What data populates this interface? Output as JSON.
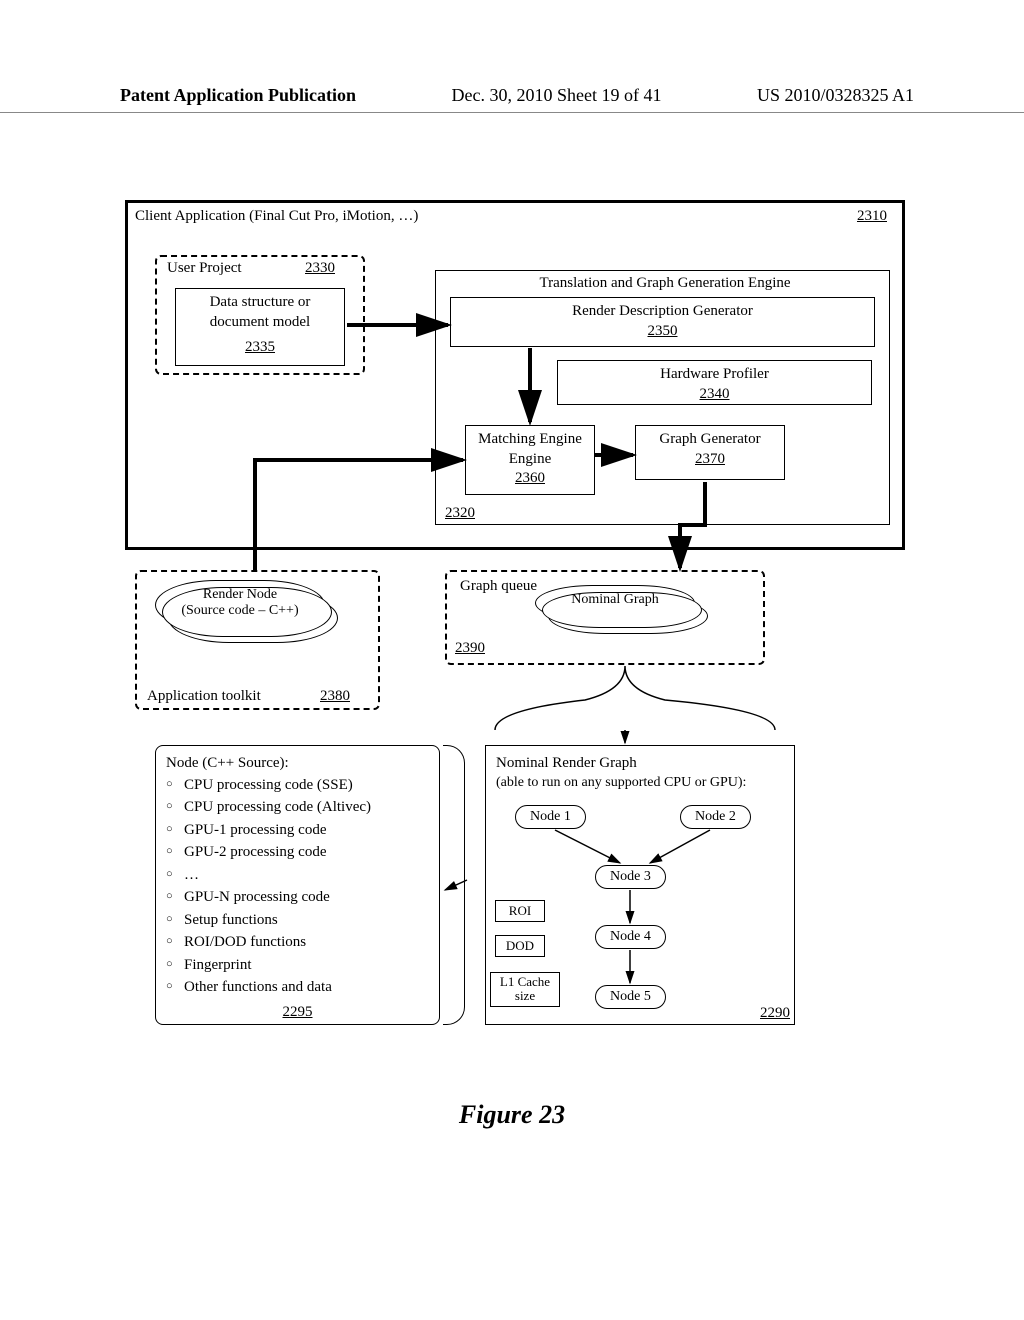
{
  "header": {
    "left": "Patent Application Publication",
    "center": "Dec. 30, 2010  Sheet 19 of 41",
    "right": "US 2010/0328325 A1"
  },
  "figure_caption": "Figure 23",
  "client_app": {
    "title": "Client Application (Final Cut Pro, iMotion, …)",
    "ref": "2310"
  },
  "user_project": {
    "title": "User Project",
    "ref": "2330",
    "inner": "Data structure or document model",
    "inner_ref": "2335"
  },
  "translation": {
    "title": "Translation and Graph Generation Engine",
    "sub": "Render Description Generator",
    "sub_ref": "2350",
    "hw": "Hardware Profiler",
    "hw_ref": "2340",
    "matching": "Matching Engine",
    "matching_ref": "2360",
    "gg": "Graph Generator",
    "gg_ref": "2370",
    "outer_ref": "2320"
  },
  "toolkit": {
    "rn1": "Render Node",
    "rn2": "(Source code – C++)",
    "title": "Application toolkit",
    "ref": "2380"
  },
  "graph_queue": {
    "title": "Graph queue",
    "nominal": "Nominal Graph",
    "ref": "2390"
  },
  "node_source": {
    "title": "Node (C++ Source):",
    "items": [
      "CPU processing code (SSE)",
      "CPU processing code (Altivec)",
      "GPU-1 processing code",
      "GPU-2 processing code",
      "…",
      "GPU-N processing code",
      "Setup functions",
      "ROI/DOD functions",
      "Fingerprint",
      "Other functions and data"
    ],
    "ref": "2295"
  },
  "render_graph": {
    "title": "Nominal Render Graph",
    "sub": "(able to run on any supported CPU or GPU):",
    "nodes": [
      "Node 1",
      "Node 2",
      "Node 3",
      "Node 4",
      "Node 5"
    ],
    "tags": [
      "ROI",
      "DOD",
      "L1 Cache size"
    ],
    "ref": "2290"
  }
}
